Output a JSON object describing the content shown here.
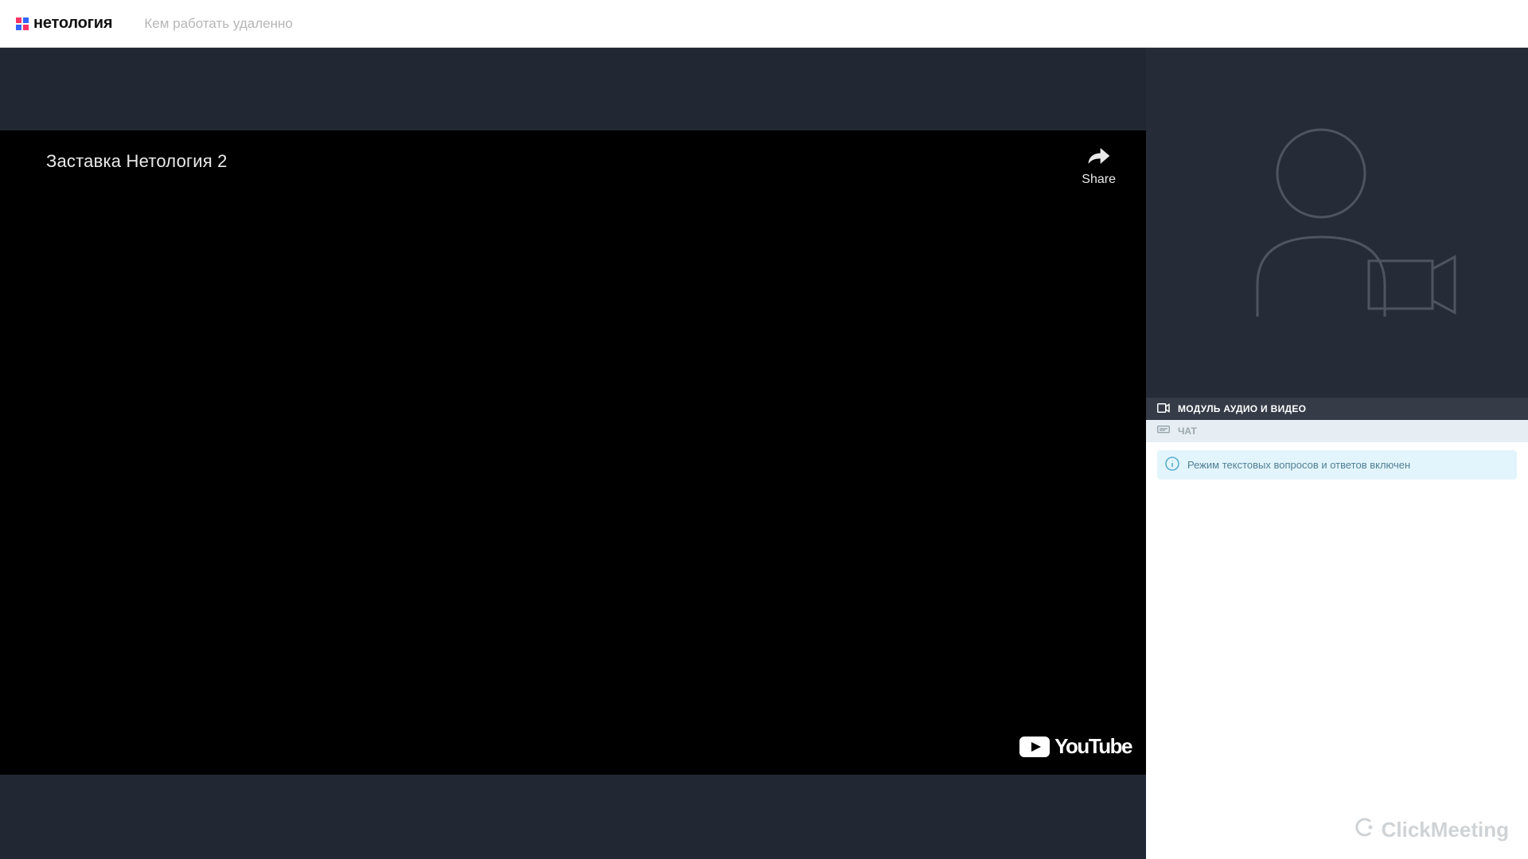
{
  "header": {
    "brand": "нетология",
    "breadcrumb": "Кем работать удаленно"
  },
  "player": {
    "title": "Заставка Нетология 2",
    "share_label": "Share",
    "provider": "YouTube"
  },
  "sidebar": {
    "av_module_label": "МОДУЛЬ АУДИО И ВИДЕО",
    "chat_label": "ЧАТ",
    "notice_text": "Режим текстовых вопросов и ответов включен",
    "platform_brand": "ClickMeeting"
  }
}
